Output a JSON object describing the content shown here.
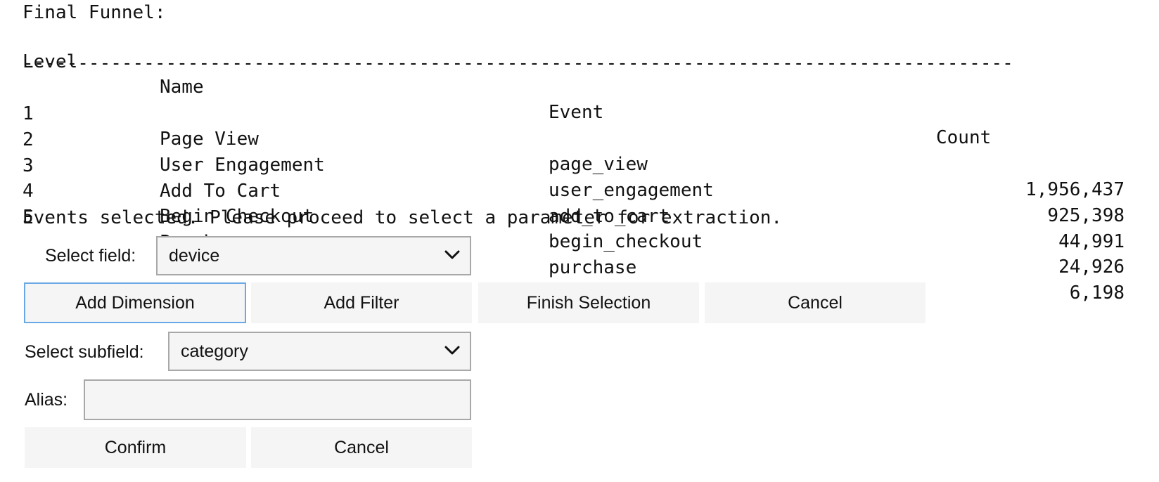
{
  "funnel": {
    "title": "Final Funnel:",
    "headers": {
      "level": "Level",
      "name": "Name",
      "event": "Event",
      "count": "Count"
    },
    "separator": "------------------------------------------------------------------------------------------",
    "rows": [
      {
        "level": "1",
        "name": "Page View",
        "event": "page_view",
        "count": "1,956,437"
      },
      {
        "level": "2",
        "name": "User Engagement",
        "event": "user_engagement",
        "count": "925,398"
      },
      {
        "level": "3",
        "name": "Add To Cart",
        "event": "add_to_cart",
        "count": "44,991"
      },
      {
        "level": "4",
        "name": "Begin Checkout",
        "event": "begin_checkout",
        "count": "24,926"
      },
      {
        "level": "5",
        "name": "Purchase",
        "event": "purchase",
        "count": "6,198"
      }
    ],
    "status_message": "Events selected. Please proceed to select a parameter for extraction."
  },
  "field_select": {
    "label": "Select field:",
    "value": "device"
  },
  "actions": {
    "add_dimension": "Add Dimension",
    "add_filter": "Add Filter",
    "finish_selection": "Finish Selection",
    "cancel": "Cancel"
  },
  "subfield_select": {
    "label": "Select subfield:",
    "value": "category"
  },
  "alias": {
    "label": "Alias:",
    "value": ""
  },
  "confirm_actions": {
    "confirm": "Confirm",
    "cancel": "Cancel"
  },
  "icons": {
    "select_chevron": "chevron-down-icon"
  },
  "colors": {
    "focus_border": "#6aa9e6",
    "button_bg": "#f5f5f5",
    "input_border": "#a8a8a8"
  }
}
